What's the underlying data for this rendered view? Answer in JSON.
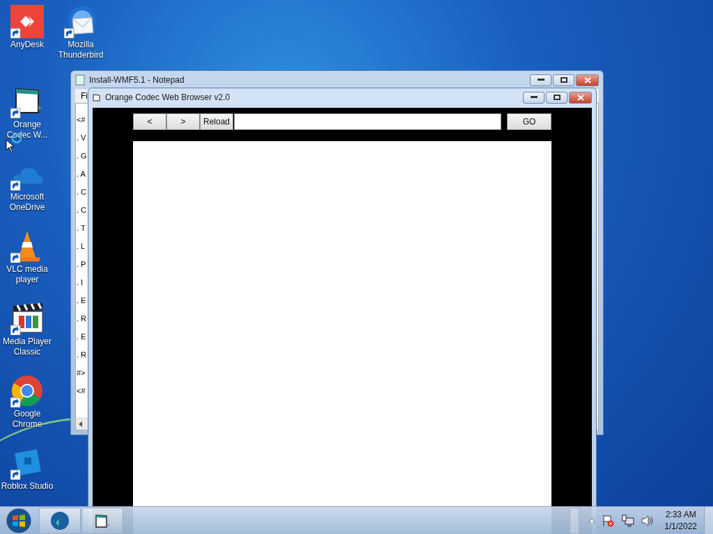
{
  "desktop_icons": [
    {
      "label": "AnyDesk",
      "kind": "anydesk"
    },
    {
      "label": "Mozilla Thunderbird",
      "kind": "mail"
    },
    {
      "label": "Orange Codec W...",
      "kind": "window"
    },
    {
      "label": "Microsoft OneDrive",
      "kind": "cloud"
    },
    {
      "label": "VLC media player",
      "kind": "cone"
    },
    {
      "label": "Media Player Classic",
      "kind": "clapper"
    },
    {
      "label": "Google Chrome",
      "kind": "chrome"
    },
    {
      "label": "Roblox Studio",
      "kind": "roblox"
    }
  ],
  "notepad": {
    "title": "Install-WMF5.1 - Notepad",
    "menu": "Fi",
    "lines": [
      "<#",
      ". V",
      ". G",
      ". A",
      ". C",
      ". C",
      ". T",
      ". L",
      ". P",
      ". I",
      ". E",
      ". R",
      ". E",
      ". R",
      "#>",
      "<#"
    ]
  },
  "browser": {
    "title": "Orange Codec Web Browser v2.0",
    "back": "<",
    "forward": ">",
    "reload": "Reload",
    "go": "GO"
  },
  "taskbar": {
    "buttons": [
      {
        "kind": "app"
      },
      {
        "kind": "window"
      }
    ],
    "time": "2:33 AM",
    "date": "1/1/2022"
  }
}
